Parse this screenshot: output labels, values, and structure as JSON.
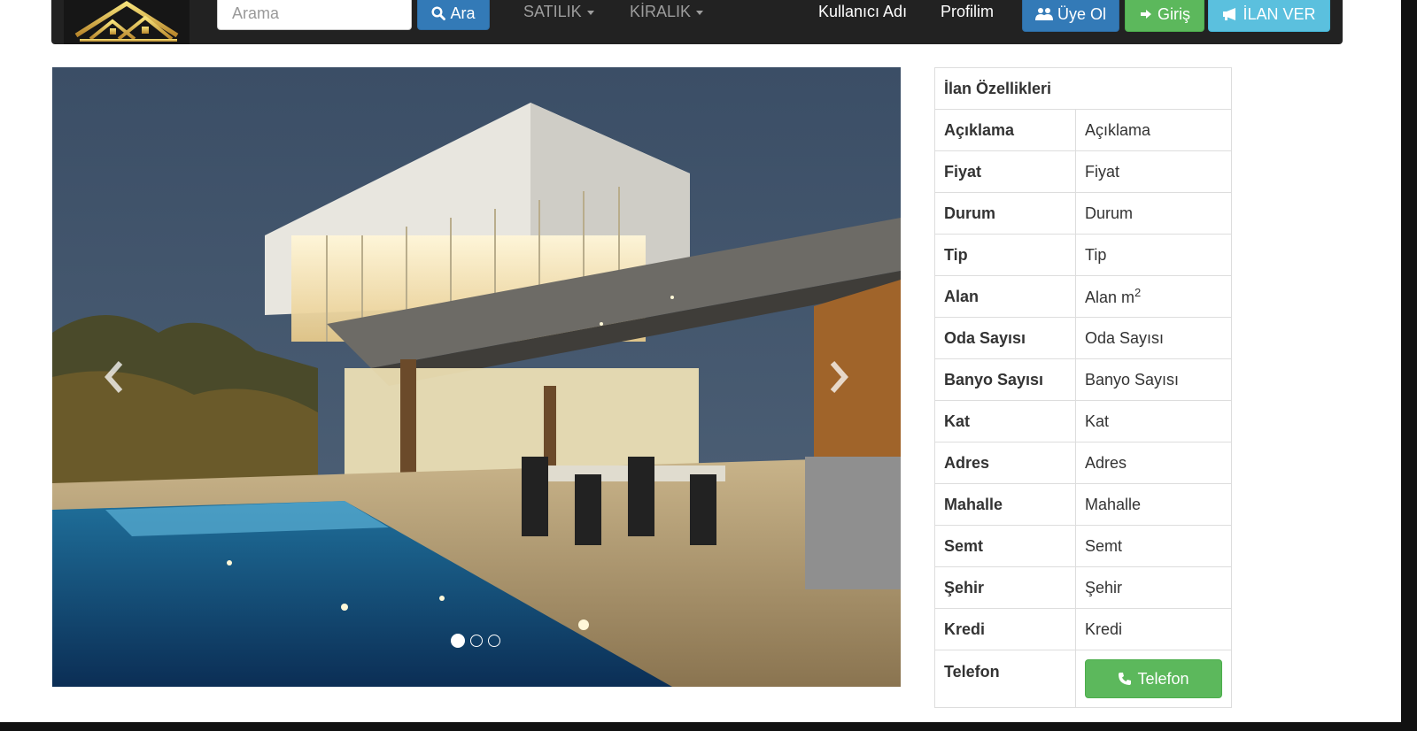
{
  "navbar": {
    "logo_icon": "house-logo-icon",
    "search_placeholder": "Arama",
    "search_button": "Ara",
    "menu": [
      {
        "label": "SATILIK"
      },
      {
        "label": "KİRALIK"
      }
    ],
    "username": "Kullanıcı Adı",
    "profile": "Profilim",
    "signup": "Üye Ol",
    "login": "Giriş",
    "post_ad": "İLAN VER",
    "colors": {
      "primary": "#337ab7",
      "success": "#5cb85c",
      "info": "#5bc0de",
      "navbar": "#222222"
    }
  },
  "carousel": {
    "slide_count": 3,
    "active_index": 0,
    "prev_icon": "chevron-left-icon",
    "next_icon": "chevron-right-icon"
  },
  "properties": {
    "title": "İlan Özellikleri",
    "rows": [
      {
        "key": "Açıklama",
        "value": "Açıklama"
      },
      {
        "key": "Fiyat",
        "value": "Fiyat"
      },
      {
        "key": "Durum",
        "value": "Durum"
      },
      {
        "key": "Tip",
        "value": "Tip"
      },
      {
        "key": "Alan",
        "value": "Alan m",
        "sup": "2"
      },
      {
        "key": "Oda Sayısı",
        "value": "Oda Sayısı"
      },
      {
        "key": "Banyo Sayısı",
        "value": "Banyo Sayısı"
      },
      {
        "key": "Kat",
        "value": "Kat"
      },
      {
        "key": "Adres",
        "value": "Adres"
      },
      {
        "key": "Mahalle",
        "value": "Mahalle"
      },
      {
        "key": "Semt",
        "value": "Semt"
      },
      {
        "key": "Şehir",
        "value": "Şehir"
      },
      {
        "key": "Kredi",
        "value": "Kredi"
      }
    ],
    "phone_key": "Telefon",
    "phone_button": "Telefon"
  }
}
